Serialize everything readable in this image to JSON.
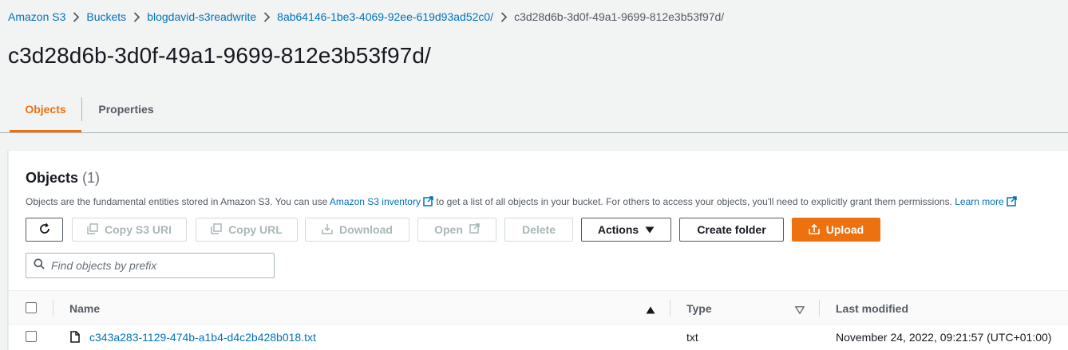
{
  "breadcrumb": {
    "items": [
      "Amazon S3",
      "Buckets",
      "blogdavid-s3readwrite",
      "8ab64146-1be3-4069-92ee-619d93ad52c0/"
    ],
    "current": "c3d28d6b-3d0f-49a1-9699-812e3b53f97d/"
  },
  "page": {
    "title": "c3d28d6b-3d0f-49a1-9699-812e3b53f97d/"
  },
  "tabs": [
    {
      "label": "Objects",
      "active": true
    },
    {
      "label": "Properties",
      "active": false
    }
  ],
  "objects_panel": {
    "title": "Objects",
    "count": "(1)",
    "description_before": "Objects are the fundamental entities stored in Amazon S3. You can use ",
    "inventory_link": "Amazon S3 inventory",
    "description_after": " to get a list of all objects in your bucket. For others to access your objects, you'll need to explicitly grant them permissions. ",
    "learn_more": "Learn more"
  },
  "toolbar": {
    "copy_s3_uri": "Copy S3 URI",
    "copy_url": "Copy URL",
    "download": "Download",
    "open": "Open",
    "delete": "Delete",
    "actions": "Actions",
    "create_folder": "Create folder",
    "upload": "Upload"
  },
  "search": {
    "placeholder": "Find objects by prefix"
  },
  "table": {
    "columns": [
      "Name",
      "Type",
      "Last modified"
    ],
    "rows": [
      {
        "name": "c343a283-1129-474b-a1b4-d4c2b428b018.txt",
        "type": "txt",
        "last_modified": "November 24, 2022, 09:21:57 (UTC+01:00)"
      }
    ]
  },
  "colors": {
    "accent": "#ec7211",
    "link": "#0073bb",
    "text": "#16191f",
    "muted": "#545b64",
    "background": "#f2f3f3"
  },
  "icons": [
    "chevron-right-icon",
    "external-link-icon",
    "refresh-icon",
    "copy-icon",
    "download-icon",
    "caret-down-icon",
    "upload-icon",
    "search-icon",
    "sort-ascending-icon",
    "sort-icon",
    "file-icon"
  ]
}
